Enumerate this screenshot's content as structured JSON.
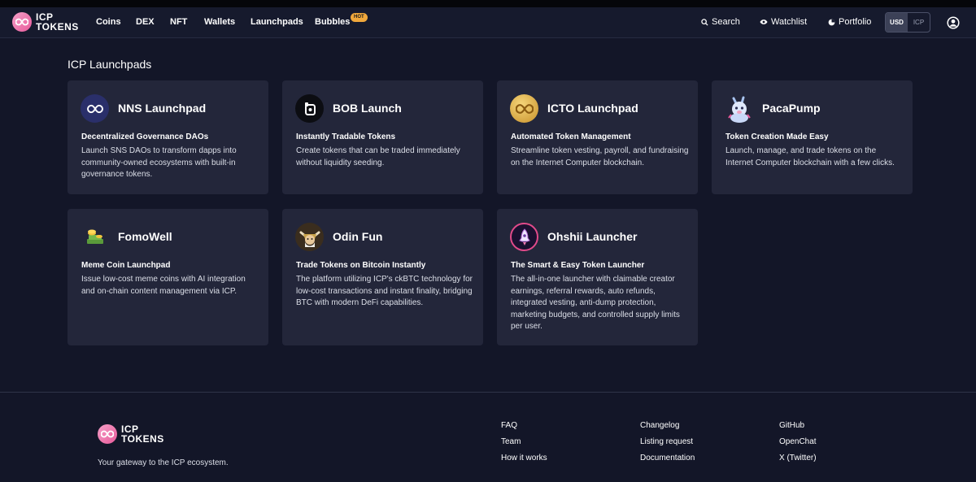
{
  "brand": {
    "line1": "ICP",
    "line2": "TOKENS"
  },
  "nav": [
    {
      "label": "Coins"
    },
    {
      "label": "DEX"
    },
    {
      "label": "NFT"
    },
    {
      "label": "Wallets"
    },
    {
      "label": "Launchpads"
    },
    {
      "label": "Bubbles"
    }
  ],
  "badge_hot": "HOT",
  "header_right": {
    "search": "Search",
    "watchlist": "Watchlist",
    "portfolio": "Portfolio",
    "currency_usd": "USD",
    "currency_icp": "ICP"
  },
  "page_title": "ICP Launchpads",
  "cards": [
    {
      "name": "NNS Launchpad",
      "subtitle": "Decentralized Governance DAOs",
      "description": "Launch SNS DAOs to transform dapps into community-owned ecosystems with built-in governance tokens.",
      "icon": "infinity-icon"
    },
    {
      "name": "BOB Launch",
      "subtitle": "Instantly Tradable Tokens",
      "description": "Create tokens that can be traded immediately without liquidity seeding.",
      "icon": "bob-icon"
    },
    {
      "name": "ICTO Launchpad",
      "subtitle": "Automated Token Management",
      "description": "Streamline token vesting, payroll, and fundraising on the Internet Computer blockchain.",
      "icon": "icto-coin-icon"
    },
    {
      "name": "PacaPump",
      "subtitle": "Token Creation Made Easy",
      "description": "Launch, manage, and trade tokens on the Internet Computer blockchain with a few clicks.",
      "icon": "alpaca-icon"
    },
    {
      "name": "FomoWell",
      "subtitle": "Meme Coin Launchpad",
      "description": "Issue low-cost meme coins with AI integration and on-chain content management via ICP.",
      "icon": "coin-stack-icon"
    },
    {
      "name": "Odin Fun",
      "subtitle": "Trade Tokens on Bitcoin Instantly",
      "description": "The platform utilizing ICP's ckBTC technology for low-cost transactions and instant finality, bridging BTC with modern DeFi capabilities.",
      "icon": "odin-icon"
    },
    {
      "name": "Ohshii Launcher",
      "subtitle": "The Smart & Easy Token Launcher",
      "description": "The all-in-one launcher with claimable creator earnings, referral rewards, auto refunds, integrated vesting, anti-dump protection, marketing budgets, and controlled supply limits per user.",
      "icon": "rocket-icon"
    }
  ],
  "footer": {
    "tagline": "Your gateway to the ICP ecosystem.",
    "col1": [
      "FAQ",
      "Team",
      "How it works"
    ],
    "col2": [
      "Changelog",
      "Listing request",
      "Documentation"
    ],
    "col3": [
      "GitHub",
      "OpenChat",
      "X (Twitter)"
    ]
  },
  "colors": {
    "background": "#131628",
    "card": "#23263a",
    "hot_badge": "#f0a83c",
    "brand_pink": "#e85a9a"
  }
}
